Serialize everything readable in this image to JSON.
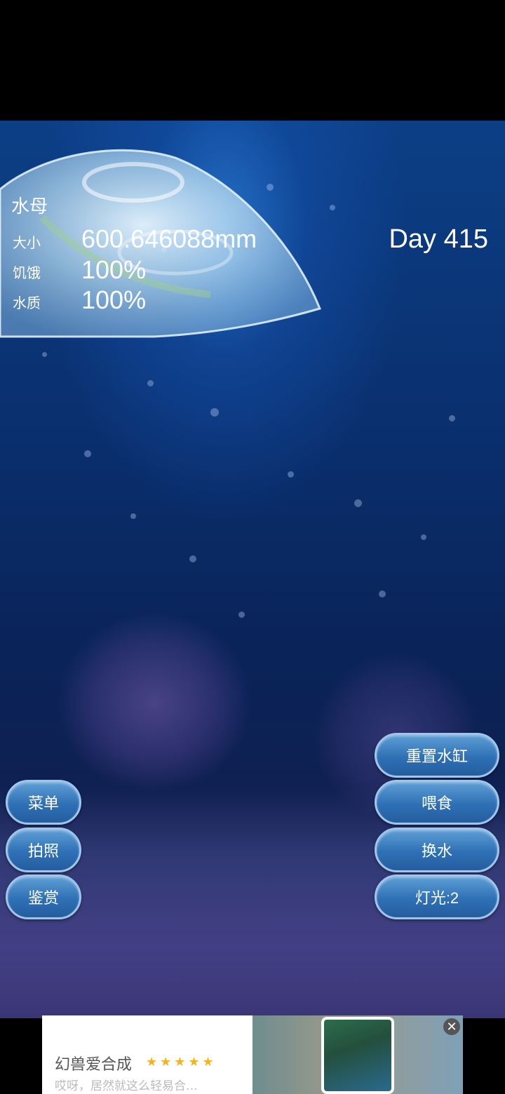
{
  "stats": {
    "title": "水母",
    "size_label": "大小",
    "size_value": "600.646088mm",
    "hunger_label": "饥饿",
    "hunger_value": "100%",
    "water_label": "水质",
    "water_value": "100%"
  },
  "day": "Day 415",
  "left_buttons": [
    "菜单",
    "拍照",
    "鉴赏"
  ],
  "right_buttons": [
    "重置水缸",
    "喂食",
    "换水",
    "灯光:2"
  ],
  "ad": {
    "title": "幻兽爱合成",
    "stars": "★★★★★",
    "description": "哎呀，居然就这么轻易合…",
    "close_glyph": "✕"
  },
  "icons": {
    "close": "close-icon",
    "star": "star-icon"
  },
  "colors": {
    "button_fill": "#2f70b6",
    "button_border": "#9fc6ea",
    "star": "#f5b324"
  }
}
